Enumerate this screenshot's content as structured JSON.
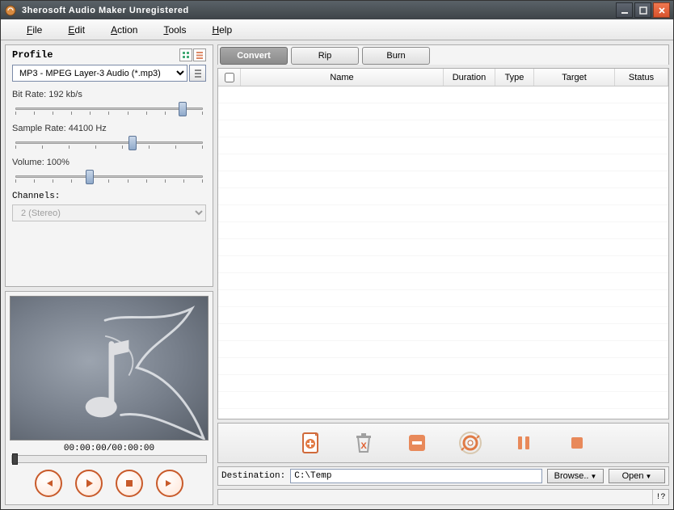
{
  "window": {
    "title": "3herosoft Audio Maker Unregistered"
  },
  "menu": {
    "file": "File",
    "edit": "Edit",
    "action": "Action",
    "tools": "Tools",
    "help": "Help"
  },
  "profile": {
    "header": "Profile",
    "format_selected": "MP3 - MPEG Layer-3 Audio  (*.mp3)",
    "bitrate_label": "Bit Rate: 192 kb/s",
    "samplerate_label": "Sample Rate: 44100 Hz",
    "volume_label": "Volume: 100%",
    "channels_label": "Channels:",
    "channels_value": "2 (Stereo)",
    "bitrate_pos_pct": 88,
    "samplerate_pos_pct": 62,
    "volume_pos_pct": 40
  },
  "preview": {
    "time": "00:00:00/00:00:00"
  },
  "tabs": {
    "convert": "Convert",
    "rip": "Rip",
    "burn": "Burn"
  },
  "columns": {
    "name": "Name",
    "duration": "Duration",
    "type": "Type",
    "target": "Target",
    "status": "Status"
  },
  "destination": {
    "label": "Destination:",
    "value": "C:\\Temp",
    "browse": "Browse..",
    "open": "Open"
  },
  "statusbar": {
    "hint": "!?"
  }
}
